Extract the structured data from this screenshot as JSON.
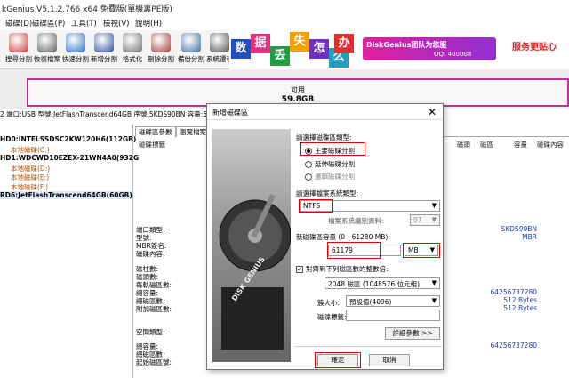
{
  "window": {
    "title": "kGenius V5.1.2.766 x64 免費版(單機裏PE版)"
  },
  "menu": [
    "磁碟(D)",
    "磁碟區(P)",
    "工具(T)",
    "檢視(V)",
    "說明(H)"
  ],
  "toolbar": [
    {
      "label": "搜尋分割",
      "icon": "search-icon",
      "color": "#c84040"
    },
    {
      "label": "恢復檔案",
      "icon": "restore-icon",
      "color": "#606060"
    },
    {
      "label": "快速分割",
      "icon": "quick-partition-icon",
      "color": "#2a70c0"
    },
    {
      "label": "新增分割",
      "icon": "new-partition-icon",
      "color": "#3050a0"
    },
    {
      "label": "格式化",
      "icon": "format-icon",
      "color": "#707070"
    },
    {
      "label": "刪除分割",
      "icon": "delete-partition-icon",
      "color": "#a04040"
    },
    {
      "label": "備份分割",
      "icon": "backup-icon",
      "color": "#4070a0"
    },
    {
      "label": "系統遷移",
      "icon": "migrate-icon",
      "color": "#505050"
    }
  ],
  "banner": {
    "chars": [
      {
        "t": "数",
        "c": "#2050c0"
      },
      {
        "t": "据",
        "c": "#e03080"
      },
      {
        "t": "丢",
        "c": "#20a040"
      },
      {
        "t": "失",
        "c": "#f0a000"
      },
      {
        "t": "怎",
        "c": "#7030c0"
      },
      {
        "t": "么",
        "c": "#20a0c0"
      },
      {
        "t": "办",
        "c": "#e03030"
      }
    ],
    "brand": "DiskGenius团队为您服",
    "qq": "QQ: 400008",
    "service": "服务更贴心"
  },
  "diskmap": {
    "label": "可用",
    "size": "59.8GB"
  },
  "infoline": "2 端口:USB 型號:JetFlashTranscend64GB 序號:5KDS90BN 容量:59",
  "tree": [
    {
      "text": "HD0:INTELSSDSC2KW120H6(112GB)",
      "color": "#000",
      "bold": true,
      "indent": 0
    },
    {
      "text": "本地磁碟(C:)",
      "color": "#b05000",
      "bold": false,
      "indent": 12
    },
    {
      "text": "HD1:WDCWD10EZEX-21WN4A0(932G",
      "color": "#000",
      "bold": true,
      "indent": 0
    },
    {
      "text": "本地磁碟(D:)",
      "color": "#b05000",
      "bold": false,
      "indent": 12
    },
    {
      "text": "本地磁碟(E:)",
      "color": "#b05000",
      "bold": false,
      "indent": 12
    },
    {
      "text": "本地磁碟(F:)",
      "color": "#b05000",
      "bold": false,
      "indent": 12
    },
    {
      "text": "RD6:JetFlashTranscend64GB(60GB)",
      "color": "#000",
      "bold": true,
      "indent": 0
    }
  ],
  "tabs": [
    "磁碟區參數",
    "瀏覽檔案"
  ],
  "columns": [
    "磁碟標籤",
    "磁頭",
    "磁區",
    "容量",
    "磁碟內容"
  ],
  "details": {
    "labels1": [
      "端口類型:",
      "型號:",
      "MBR簽名:",
      "磁碟內容:"
    ],
    "labels2": [
      "磁柱數:",
      "磁頭數:",
      "每軌磁區數:",
      "總容量:",
      "總磁區數:",
      "附加磁區數:"
    ],
    "labels3": [
      "空間類型:"
    ],
    "labels4": [
      "總容量:",
      "總磁區數:",
      "起始磁區號:"
    ],
    "values1": [
      "SKDS90BN",
      "MBR"
    ],
    "values2": [
      "64256737280",
      "512 Bytes",
      "512 Bytes"
    ],
    "values4": [
      "64256737280"
    ]
  },
  "dialog": {
    "title": "新增磁碟區",
    "ptype_label": "請選擇磁碟區類型:",
    "ptype_options": [
      "主要磁碟分割",
      "延伸磁碟分割",
      "邏輯磁碟分割"
    ],
    "fs_label": "請選擇檔案系統類型:",
    "fs_value": "NTFS",
    "sysid_label": "檔案系統識別資料:",
    "sysid_value": "07",
    "size_label": "新磁碟區容量 (0 - 61280 MB):",
    "size_value": "61179",
    "unit_value": "MB",
    "align_label": "對齊到下列磁區數的整數倍:",
    "align_value": "2048 磁區 (1048576 位元組)",
    "cluster_label": "簇大小:",
    "cluster_value": "預設值(4096)",
    "vollabel_label": "磁碟標籤:",
    "vollabel_value": "",
    "advanced_label": "詳細參數 >>",
    "ok_label": "確定",
    "cancel_label": "取消",
    "close_glyph": "✕",
    "image_text": "DISK GENIUS"
  }
}
